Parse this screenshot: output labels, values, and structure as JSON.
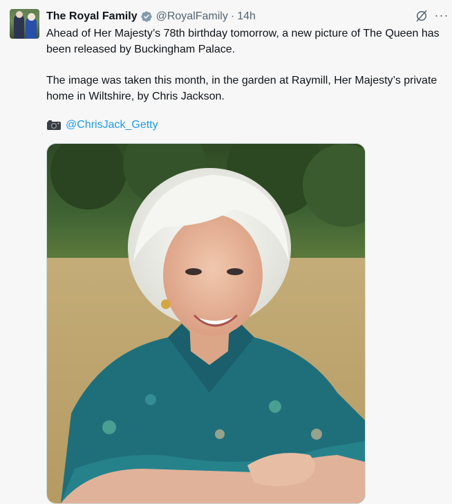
{
  "tweet": {
    "author_name": "The Royal Family",
    "handle": "@RoyalFamily",
    "separator": "·",
    "time": "14h",
    "paragraph_1": "Ahead of Her Majesty’s 78th birthday tomorrow, a new picture of The Queen has been released by Buckingham Palace.",
    "paragraph_2": "The image was taken this month, in the garden at Raymill, Her Majesty’s private home in Wiltshire, by Chris Jackson.",
    "credit_mention": "@ChrisJack_Getty",
    "more_label": "···"
  },
  "icons": {
    "verified": "verified-badge-icon",
    "grok": "grok-icon",
    "more": "more-options-icon",
    "camera": "camera-emoji-icon"
  },
  "colors": {
    "accent": "#1d9bf0",
    "verified_badge": "#829aab",
    "secondary_text": "#536471"
  }
}
